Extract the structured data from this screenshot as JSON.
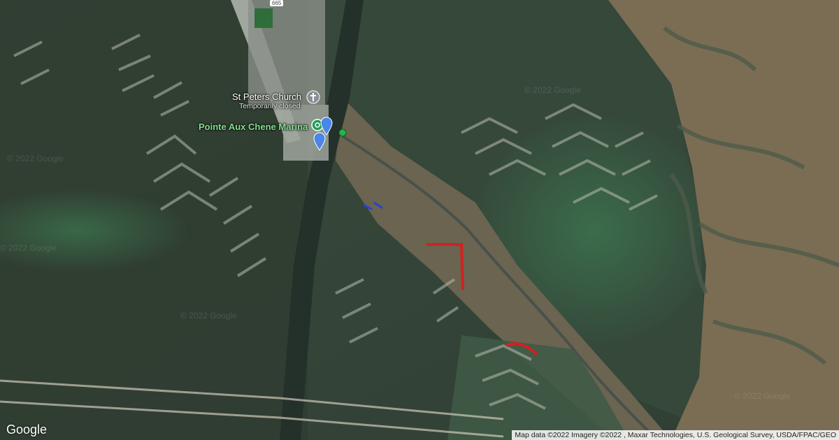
{
  "places": {
    "church_name": "St Peters Church",
    "church_status": "Temporarily closed",
    "marina_name": "Pointe Aux Chene Marina"
  },
  "road_shield": "665",
  "watermarks": [
    "© 2022 Google",
    "© 2022 Google",
    "© 2022 Google",
    "© 2022 Google",
    "© 2022 Google"
  ],
  "google_logo": "Google",
  "attribution": "Map data ©2022 Imagery ©2022 , Maxar Technologies, U.S. Geological Survey, USDA/FPAC/GEO",
  "icons": {
    "church": "church-icon",
    "marina": "marina-icon",
    "markers": [
      "map-marker-blue",
      "map-marker-blue"
    ],
    "point": "green-dot-marker"
  },
  "colors": {
    "water": "#3c4d3f",
    "marsh": "#8a7a5e",
    "road": "#b9c0bb",
    "marker_blue": "#4a86e8",
    "red_line": "#d42020",
    "blue_line": "#2a3fd8",
    "green_dot": "#1fb84a"
  }
}
